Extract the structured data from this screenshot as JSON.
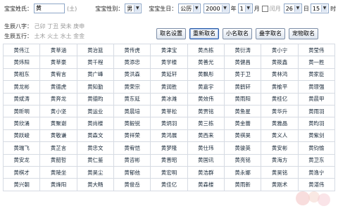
{
  "form": {
    "surname_label": "宝宝姓氏：",
    "surname_value": "黄",
    "surname_hint": "(土)",
    "gender_label": "宝宝性别：",
    "gender_value": "男",
    "birth_label": "宝宝生日：",
    "calendar_value": "公历",
    "year_value": "2000",
    "year_unit": "年",
    "month_value": "1",
    "month_unit": "月",
    "leap_label": "闰月",
    "day_value": "26",
    "day_unit": "日",
    "hour_value": "15",
    "hour_unit": "时"
  },
  "bazi": {
    "label": "生辰八字：",
    "value": "己卯 丁丑 癸未 庚申"
  },
  "wuxing": {
    "label": "生辰五行：",
    "value": "土木 火土 水土 金金"
  },
  "buttons": [
    {
      "label": "取名设置"
    },
    {
      "label": "重新取名"
    },
    {
      "label": "小名取名"
    },
    {
      "label": "叠字取名"
    },
    {
      "label": "宠物取名"
    }
  ],
  "names": [
    [
      "黄伟江",
      "黄莘涵",
      "黄治篮",
      "黄传虎",
      "黄津宝",
      "黄杰栋",
      "黄衍涛",
      "黄小宁",
      "黄莹伟"
    ],
    [
      "黄炜阳",
      "黄莘豪",
      "黄千程",
      "黄添忠",
      "黄学楼",
      "黄善光",
      "黄健昌",
      "黄筱鑫",
      "黄一胜"
    ],
    [
      "黄相东",
      "黄宥言",
      "黄广峰",
      "黄洪森",
      "黄延轩",
      "黄飘彤",
      "黄于卫",
      "黄林鸿",
      "黄家臣"
    ],
    [
      "黄龙彬",
      "黄德虎",
      "黄知勤",
      "黄荣宗",
      "黄润胜",
      "黄嘉宇",
      "黄鹤轩",
      "黄榆平",
      "黄璟强"
    ],
    [
      "黄斌涛",
      "黄奔龙",
      "黄德昀",
      "黄东延",
      "黄冰潍",
      "黄效伟",
      "黄雨阳",
      "黄桂亿",
      "黄晨甲"
    ],
    [
      "黄昕明",
      "黄小坚",
      "黄运业",
      "黄晨培",
      "黄莘松",
      "黄贾铭",
      "黄鱼星",
      "黄华升",
      "黄雨羽"
    ],
    [
      "黄欣涌",
      "黄聚谢",
      "黄尚楼",
      "黄毅锐",
      "黄炳羽",
      "黄三栋",
      "黄金蕾",
      "黄雅晶",
      "黄昀羽"
    ],
    [
      "黄跃峻",
      "黄敬谦",
      "黄森文",
      "黄祥荣",
      "黄鸿展",
      "黄西来",
      "黄祺昊",
      "黄义人",
      "黄紫剑"
    ],
    [
      "黄瑞飞",
      "黄芷言",
      "黄忠文",
      "黄宥恺",
      "黄梦隆",
      "黄仕玮",
      "黄骏英",
      "黄安彬",
      "黄钧愉"
    ],
    [
      "黄安龙",
      "黄韶哲",
      "黄仁鉴",
      "黄咨彬",
      "黄晋昭",
      "黄国讯",
      "黄亮铭",
      "黄海方",
      "黄卫东"
    ],
    [
      "黄棋才",
      "黄陵坐",
      "黄昊尘",
      "黄郁他",
      "黄宏明",
      "黄浩群",
      "黄永娜",
      "黄昊铭",
      "黄逸宁"
    ],
    [
      "黄兴朝",
      "黄烽阳",
      "黄大畅",
      "黄俊岳",
      "黄佳亿",
      "黄森楼",
      "黄雨新",
      "黄刚术",
      "黄湛伟"
    ]
  ],
  "colors": {
    "cell_border": "#d6dbe3",
    "input_border": "#8ea7c8",
    "button_active": "#2f5fa8"
  }
}
